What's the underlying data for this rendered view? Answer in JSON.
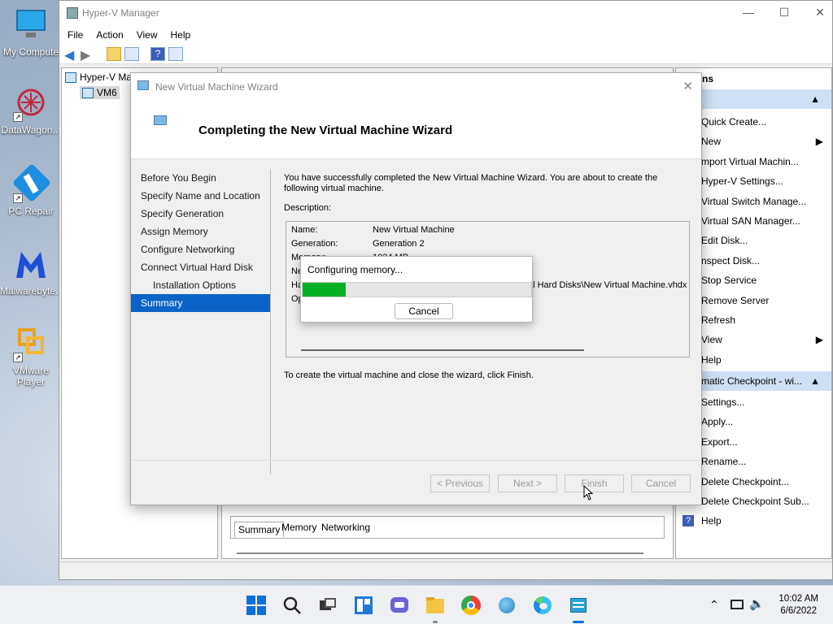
{
  "desktop": {
    "icons": [
      {
        "label": "My Compute"
      },
      {
        "label": "DataWagon..."
      },
      {
        "label": "PC Repair"
      },
      {
        "label": "Malwarebyte..."
      },
      {
        "label": "VMware Player"
      }
    ]
  },
  "hyperv": {
    "title": "Hyper-V Manager",
    "menu": [
      "File",
      "Action",
      "View",
      "Help"
    ],
    "tree": {
      "root": "Hyper-V Ma",
      "child": "VM6"
    },
    "center_tabs": [
      "Summary",
      "Memory",
      "Networking"
    ],
    "actions": {
      "header1": "ns",
      "items1": [
        "Quick Create...",
        "New",
        "mport Virtual Machin...",
        "Hyper-V Settings...",
        "Virtual Switch Manage...",
        "Virtual SAN Manager...",
        "Edit Disk...",
        "nspect Disk...",
        "Stop Service",
        "Remove Server",
        "Refresh",
        "View",
        "Help"
      ],
      "header2": "matic Checkpoint - wi...",
      "items2": [
        "Settings...",
        "Apply...",
        "Export...",
        "Rename...",
        "Delete Checkpoint...",
        "Delete Checkpoint Sub...",
        "Help"
      ]
    }
  },
  "wizard": {
    "title": "New Virtual Machine Wizard",
    "heading": "Completing the New Virtual Machine Wizard",
    "steps": [
      {
        "label": "Before You Begin",
        "sub": false,
        "active": false
      },
      {
        "label": "Specify Name and Location",
        "sub": false,
        "active": false
      },
      {
        "label": "Specify Generation",
        "sub": false,
        "active": false
      },
      {
        "label": "Assign Memory",
        "sub": false,
        "active": false
      },
      {
        "label": "Configure Networking",
        "sub": false,
        "active": false
      },
      {
        "label": "Connect Virtual Hard Disk",
        "sub": false,
        "active": false
      },
      {
        "label": "Installation Options",
        "sub": true,
        "active": false
      },
      {
        "label": "Summary",
        "sub": false,
        "active": true
      }
    ],
    "intro_line1": "You have successfully completed the New Virtual Machine Wizard. You are about to create the",
    "intro_line2": "following virtual machine.",
    "description_label": "Description:",
    "description": {
      "name_key": "Name:",
      "name_val": "New Virtual Machine",
      "gen_key": "Generation:",
      "gen_val": "Generation 2",
      "mem_key": "Memory:",
      "mem_val": "1024 MB",
      "net_key": "Ne",
      "hd_key": "Ha",
      "hd_val": "al Hard Disks\\New Virtual Machine.vhdx",
      "op_key": "Op"
    },
    "finish_note": "To create the virtual machine and close the wizard, click Finish.",
    "buttons": {
      "previous": "< Previous",
      "next": "Next >",
      "finish": "Finish",
      "cancel": "Cancel"
    }
  },
  "progress": {
    "text": "Configuring memory...",
    "value": 0.19,
    "cancel": "Cancel"
  },
  "taskbar": {
    "time": "10:02 AM",
    "date": "6/6/2022"
  }
}
